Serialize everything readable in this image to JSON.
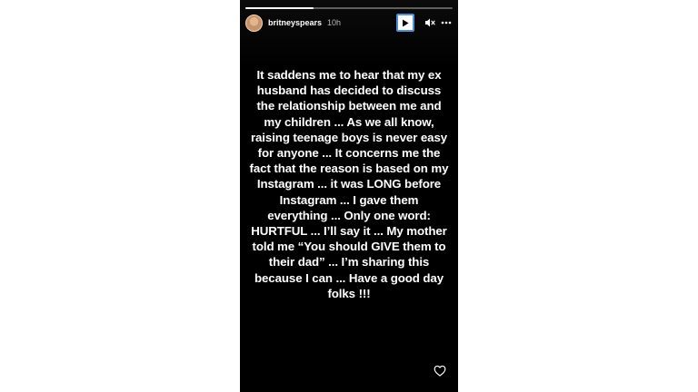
{
  "story": {
    "progress": 0.33,
    "username": "britneyspears",
    "time": "10h",
    "text": "It saddens me to hear that my ex husband has decided to discuss the relationship between me and my children ... As we all know, raising teenage boys is never easy for anyone ... It concerns me the fact that the reason is based on my Instagram ... it was LONG before Instagram ... I gave them everything ... Only one word: HURTFUL ... I’ll say it ... My mother told me “You should GIVE them to their dad” ... I’m sharing this because I can ... Have a good day folks !!!"
  },
  "controls": {
    "play_icon": "play-icon",
    "mute_icon": "mute-icon",
    "more_icon": "more-options-icon",
    "like_icon": "heart-icon"
  },
  "colors": {
    "story_bg": "#000000",
    "focus_ring": "#4a90e2"
  }
}
